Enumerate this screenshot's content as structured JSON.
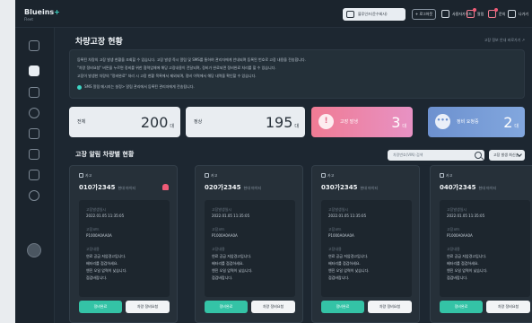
{
  "app": {
    "logo": "Blueins",
    "logo_accent": "+",
    "logo_sub": "Fleet"
  },
  "topbar": {
    "user_label": "블루인즈(운수회사)",
    "logout_label": "+ 로그아웃",
    "links": [
      {
        "label": "사용자가이드",
        "icon": "book-icon"
      },
      {
        "label": "알림",
        "icon": "bell-icon"
      },
      {
        "label": "문의",
        "icon": "message-icon"
      },
      {
        "label": "나가기",
        "icon": "exit-icon"
      }
    ]
  },
  "sidebar": {
    "items": [
      "grid-icon",
      "car-icon",
      "chart-icon",
      "settings-icon",
      "wrench-icon",
      "document-icon",
      "list-icon",
      "gear-icon"
    ]
  },
  "page": {
    "title": "차량고장 현황",
    "guide_link": "고장 정보 안내 바로가기 ↗"
  },
  "notice": {
    "lines": [
      "등록된 차량의 고장 발생 현황을 조회할 수 있습니다. 고장 발생 즉시 알림 및 SMS를 통하여 관리자에게 안내되며 등록된 번호로 고장 내용을 전송합니다.",
      "\"차량 정비요청\" 버튼을 누르면 정비를 위한 협력업체에 해당 고장내용이 전달되며, 정비가 완료되면 정비완료 처리를 할 수 있습니다.",
      "고장이 발생한 차량의 \"정비완료\" 처리 시 고장 현황 목록에서 제외되며, 정비 이력에서 해당 내역을 확인할 수 있습니다."
    ],
    "sms_note": "SMS 알림 메시지는 설정> 알림 관리에서 등록된 관리자에게 전송됩니다."
  },
  "stats": {
    "total": {
      "label": "전체",
      "value": "200",
      "unit": "대"
    },
    "normal": {
      "label": "정상",
      "value": "195",
      "unit": "대"
    },
    "fault": {
      "label": "고장 발생",
      "value": "3",
      "unit": "대",
      "icon": "!"
    },
    "repair": {
      "label": "정비 요청중",
      "value": "2",
      "unit": "대",
      "icon": "•••"
    }
  },
  "section": {
    "title": "고장 알림 차량별 현황",
    "search_placeholder": "차량번호(VIN) 검색",
    "sort_value": "고장 발생 최신순"
  },
  "cards": [
    {
      "type": "카고",
      "plate": "010가2345",
      "plate_sub": "현대 마이티",
      "alarm": true,
      "date_label": "고장발생일시",
      "date": "2022.01.05 11:35:05",
      "code_label": "고장코드",
      "code": "P1000A0AA0A",
      "desc_label": "고장내용",
      "desc": [
        "연료 공급 저압경고입니다.",
        "배터리를 점검하세요.",
        "엔진 오일 압력이 낮습니다."
      ],
      "desc_more": "점검바랍니다.",
      "btn_main": "정비완료",
      "btn_sub": "차량 정비요청"
    },
    {
      "type": "카고",
      "plate": "020가2345",
      "plate_sub": "현대 마이티",
      "alarm": false,
      "date_label": "고장발생일시",
      "date": "2022.01.05 11:35:05",
      "code_label": "고장코드",
      "code": "P1000A0AA0A",
      "desc_label": "고장내용",
      "desc": [
        "연료 공급 저압경고입니다.",
        "배터리를 점검하세요.",
        "엔진 오일 압력이 낮습니다."
      ],
      "desc_more": "점검바랍니다.",
      "btn_main": "정비완료",
      "btn_sub": "차량 정비요청"
    },
    {
      "type": "카고",
      "plate": "030가2345",
      "plate_sub": "현대 마이티",
      "alarm": false,
      "date_label": "고장발생일시",
      "date": "2022.01.05 11:35:05",
      "code_label": "고장코드",
      "code": "P1000A0AA0A",
      "desc_label": "고장내용",
      "desc": [
        "연료 공급 저압경고입니다.",
        "배터리를 점검하세요.",
        "엔진 오일 압력이 낮습니다."
      ],
      "desc_more": "점검바랍니다.",
      "btn_main": "정비완료",
      "btn_sub": "차량 정비요청"
    },
    {
      "type": "카고",
      "plate": "040가2345",
      "plate_sub": "현대 마이티",
      "alarm": false,
      "date_label": "고장발생일시",
      "date": "2022.01.05 11:35:05",
      "code_label": "고장코드",
      "code": "P1000A0AA0A",
      "desc_label": "고장내용",
      "desc": [
        "연료 공급 저압경고입니다.",
        "배터리를 점검하세요.",
        "엔진 오일 압력이 낮습니다."
      ],
      "desc_more": "점검바랍니다.",
      "btn_main": "정비완료",
      "btn_sub": "차량 정비요청"
    }
  ],
  "colors": {
    "accent": "#3dd5c4",
    "fault": "#f07b94",
    "repair": "#6d91cf",
    "complete": "#34c3a6",
    "background": "#1d2731"
  }
}
